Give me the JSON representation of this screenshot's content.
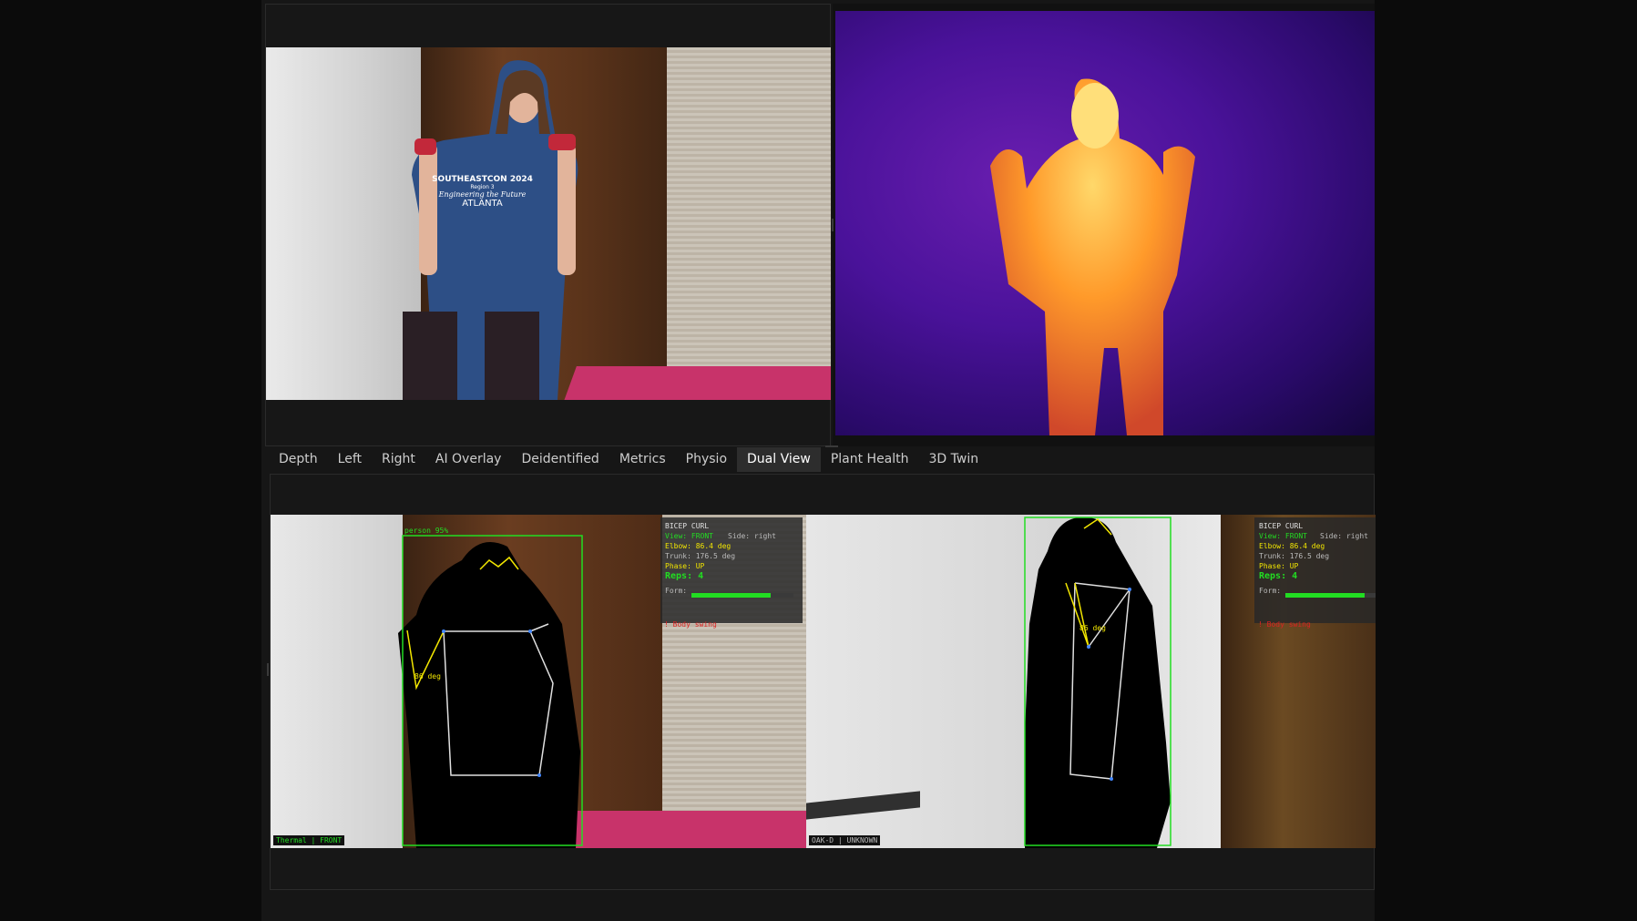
{
  "tabs": [
    {
      "label": "Depth",
      "active": false
    },
    {
      "label": "Left",
      "active": false
    },
    {
      "label": "Right",
      "active": false
    },
    {
      "label": "AI Overlay",
      "active": false
    },
    {
      "label": "Deidentified",
      "active": false
    },
    {
      "label": "Metrics",
      "active": false
    },
    {
      "label": "Physio",
      "active": false
    },
    {
      "label": "Dual View",
      "active": true
    },
    {
      "label": "Plant Health",
      "active": false
    },
    {
      "label": "3D Twin",
      "active": false
    }
  ],
  "rgb_feed": {
    "shirt_lines": [
      "SOUTHEASTCON 2024",
      "Region 3",
      "Engineering the Future",
      "ATLANTA"
    ]
  },
  "dual_view": {
    "left": {
      "detection_label": "person 95%",
      "angle_label": "86 deg",
      "camera_tag": "Thermal | FRONT",
      "stats": {
        "title": "BICEP CURL",
        "view": "View: FRONT",
        "side": "Side: right",
        "elbow": "Elbow: 86.4 deg",
        "trunk": "Trunk: 176.5 deg",
        "phase": "Phase: UP",
        "reps": "Reps: 4",
        "form_label": "Form:",
        "form_fraction": 0.78,
        "warning": "! Body swing"
      }
    },
    "right": {
      "angle_label": "86 deg",
      "camera_tag": "OAK-D | UNKNOWN",
      "stats": {
        "title": "BICEP CURL",
        "view": "View: FRONT",
        "side": "Side: right",
        "elbow": "Elbow: 86.4 deg",
        "trunk": "Trunk: 176.5 deg",
        "phase": "Phase: UP",
        "reps": "Reps: 4",
        "form_label": "Form:",
        "form_fraction": 0.78,
        "warning": "! Body swing"
      }
    }
  },
  "colors": {
    "accent_green": "#22dd22",
    "skeleton_yellow": "#f2e600",
    "table_pink": "#c8336a",
    "active_tab": "#2d2d2d"
  }
}
